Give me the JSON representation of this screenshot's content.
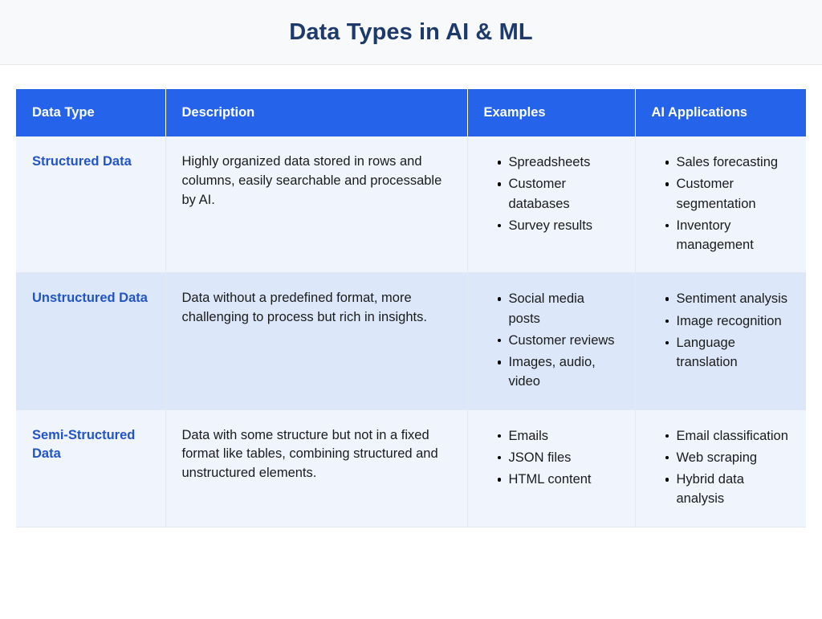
{
  "banner": {
    "title": "Data Types in AI & ML",
    "title_color": "#1e3a6b",
    "background_color": "#f8f9fb"
  },
  "table": {
    "header_background": "#2563eb",
    "header_text_color": "#ffffff",
    "row_odd_background": "#eff4fd",
    "row_even_background": "#dce8fa",
    "type_label_color": "#2254c8",
    "columns": [
      {
        "label": "Data Type"
      },
      {
        "label": "Description"
      },
      {
        "label": "Examples"
      },
      {
        "label": "AI Applications"
      }
    ],
    "rows": [
      {
        "type": "Structured Data",
        "description": "Highly organized data stored in rows and columns, easily searchable and processable by AI.",
        "examples": [
          "Spreadsheets",
          "Customer databases",
          "Survey results"
        ],
        "applications": [
          "Sales forecasting",
          "Customer segmentation",
          "Inventory management"
        ]
      },
      {
        "type": "Unstructured Data",
        "description": "Data without a predefined format, more challenging to process but rich in insights.",
        "examples": [
          "Social media posts",
          "Customer reviews",
          "Images, audio, video"
        ],
        "applications": [
          "Sentiment analysis",
          "Image recognition",
          "Language translation"
        ]
      },
      {
        "type": "Semi-Structured Data",
        "description": "Data with some structure but not in a fixed format like tables, combining structured and unstructured elements.",
        "examples": [
          "Emails",
          "JSON files",
          "HTML content"
        ],
        "applications": [
          "Email classification",
          "Web scraping",
          "Hybrid data analysis"
        ]
      }
    ]
  }
}
